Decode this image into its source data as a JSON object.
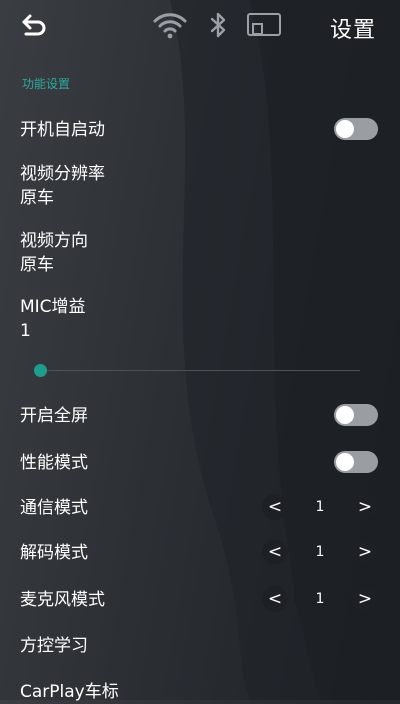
{
  "header": {
    "title": "设置",
    "icons": [
      "back-arrow-icon",
      "wifi-icon",
      "bluetooth-icon",
      "screen-cast-icon"
    ]
  },
  "section": {
    "label": "功能设置"
  },
  "settings": {
    "autostart": {
      "label": "开机自启动",
      "enabled": false
    },
    "resolution": {
      "label": "视频分辨率",
      "value": "原车"
    },
    "orientation": {
      "label": "视频方向",
      "value": "原车"
    },
    "mic_gain": {
      "label": "MIC增益",
      "value": "1",
      "slider_fraction": 0
    },
    "fullscreen": {
      "label": "开启全屏",
      "enabled": false
    },
    "performance": {
      "label": "性能模式",
      "enabled": false
    },
    "comm_mode": {
      "label": "通信模式",
      "value": "1",
      "prev": "<",
      "next": ">"
    },
    "decode_mode": {
      "label": "解码模式",
      "value": "1",
      "prev": "<",
      "next": ">"
    },
    "mic_mode": {
      "label": "麦克风模式",
      "value": "1",
      "prev": "<",
      "next": ">"
    },
    "steering_learning": {
      "label": "方控学习"
    },
    "carplay_logo": {
      "label": "CarPlay车标"
    }
  },
  "colors": {
    "accent": "#1e9e8a",
    "section_label": "#2fa9a0",
    "toggle_off": "#9a9da2",
    "stepper_bg": "#1d2126"
  }
}
